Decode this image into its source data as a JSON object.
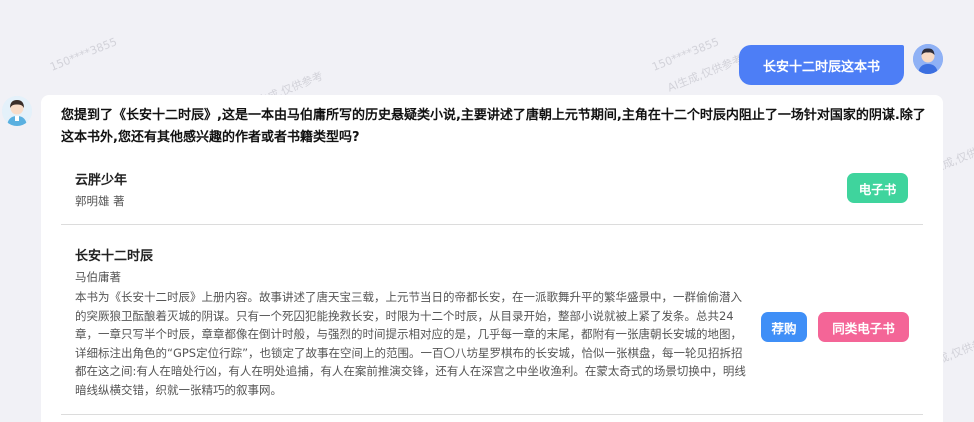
{
  "watermark": {
    "line1": "150****3855",
    "line2": "AI生成,仅供参考"
  },
  "user": {
    "message": "长安十二时辰这本书"
  },
  "assistant": {
    "intro": "您提到了《长安十二时辰》,这是一本由马伯庸所写的历史悬疑类小说,主要讲述了唐朝上元节期间,主角在十二个时辰内阻止了一场针对国家的阴谋.除了这本书外,您还有其他感兴趣的作者或者书籍类型吗?",
    "books": [
      {
        "title": "云胖少年",
        "author": "郭明雄 著",
        "ebook_label": "电子书"
      },
      {
        "title": "长安十二时辰",
        "author": "马伯庸著",
        "description": "本书为《长安十二时辰》上册内容。故事讲述了唐天宝三载，上元节当日的帝都长安，在一派歌舞升平的繁华盛景中，一群偷偷潜入的突厥狼卫酝酿着灭城的阴谋。只有一个死囚犯能挽救长安，时限为十二个时辰，从目录开始，整部小说就被上紧了发条。总共24章，一章只写半个时辰，章章都像在倒计时般，与强烈的时间提示相对应的是，几乎每一章的末尾，都附有一张唐朝长安城的地图，详细标注出角色的“GPS定位行踪”，也锁定了故事在空间上的范围。一百〇八坊星罗棋布的长安城，恰似一张棋盘，每一轮见招拆招都在这之间:有人在暗处行凶，有人在明处追捕，有人在案前推演交锋，还有人在深宫之中坐收渔利。在蒙太奇式的场景切换中，明线暗线纵横交错，织就一张精巧的叙事网。",
        "buy_label": "荐购",
        "similar_label": "同类电子书"
      }
    ]
  },
  "colors": {
    "user_bubble": "#4d7ef6",
    "ebook_button": "#3fd49d",
    "buy_button": "#3f8ff7",
    "similar_button": "#f46597",
    "page_bg": "#f1f1f6"
  }
}
